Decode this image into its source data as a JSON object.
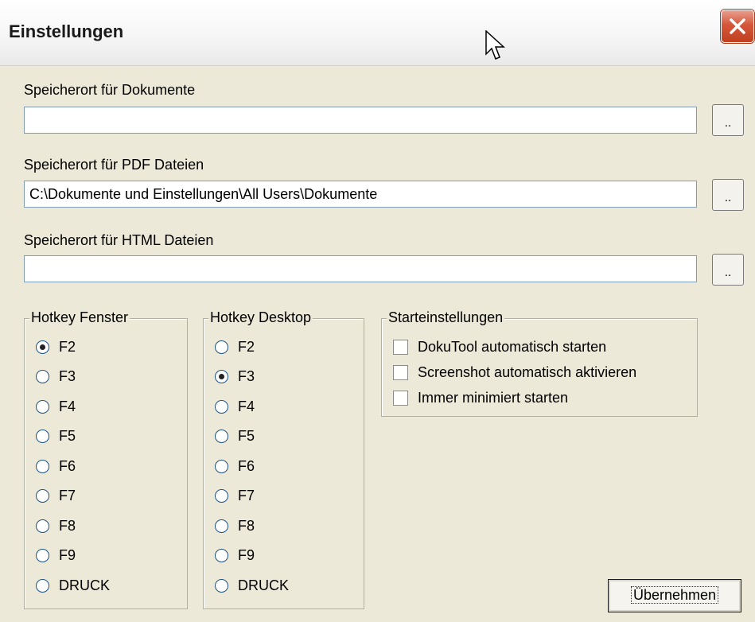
{
  "window": {
    "title": "Einstellungen"
  },
  "fields": [
    {
      "label": "Speicherort für Dokumente",
      "value": "",
      "browse_label": ".."
    },
    {
      "label": "Speicherort für PDF Dateien",
      "value": "C:\\Dokumente und Einstellungen\\All Users\\Dokumente",
      "browse_label": ".."
    },
    {
      "label": "Speicherort für HTML Dateien",
      "value": "",
      "browse_label": ".."
    }
  ],
  "hotkey_window": {
    "legend": "Hotkey Fenster",
    "options": [
      "F2",
      "F3",
      "F4",
      "F5",
      "F6",
      "F7",
      "F8",
      "F9",
      "DRUCK"
    ],
    "selected": "F2"
  },
  "hotkey_desktop": {
    "legend": "Hotkey Desktop",
    "options": [
      "F2",
      "F3",
      "F4",
      "F5",
      "F6",
      "F7",
      "F8",
      "F9",
      "DRUCK"
    ],
    "selected": "F3"
  },
  "start_settings": {
    "legend": "Starteinstellungen",
    "options": [
      {
        "label": "DokuTool automatisch starten",
        "checked": false
      },
      {
        "label": "Screenshot automatisch aktivieren",
        "checked": false
      },
      {
        "label": "Immer minimiert starten",
        "checked": false
      }
    ]
  },
  "apply_label": "Übernehmen",
  "colors": {
    "close_button": "#d5573a",
    "background": "#ece9d8"
  }
}
